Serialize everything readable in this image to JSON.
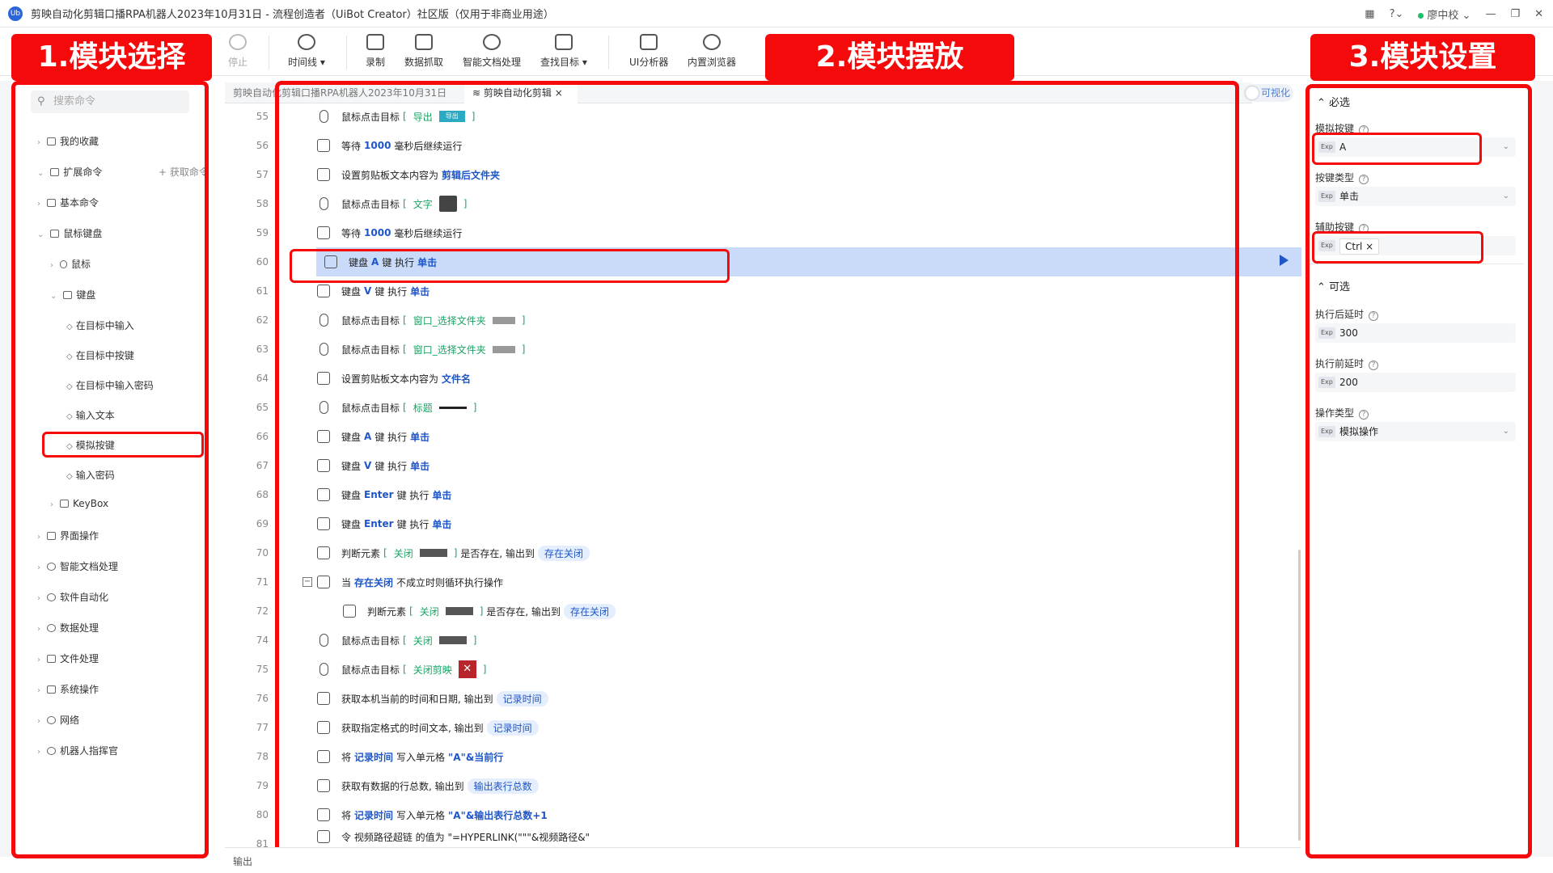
{
  "window": {
    "title": "剪映自动化剪辑口播RPA机器人2023年10月31日 - 流程创造者（UiBot Creator）社区版（仅用于非商业用途）",
    "user": "廖中校",
    "logo": "Ub"
  },
  "toolbar": {
    "stop": "停止",
    "timeline": "时间线",
    "record": "录制",
    "data_scrape": "数据抓取",
    "smart_doc": "智能文档处理",
    "find_target": "查找目标",
    "ui_analyzer": "UI分析器",
    "builtin_browser": "内置浏览器"
  },
  "labels": {
    "section1": "1.模块选择",
    "section2": "2.模块摆放",
    "section3": "3.模块设置"
  },
  "left": {
    "search_placeholder": "搜索命令",
    "get_cmd": "获取命令",
    "items": {
      "fav": "我的收藏",
      "ext": "扩展命令",
      "basic": "基本命令",
      "mousekbd": "鼠标键盘",
      "mouse": "鼠标",
      "kbd": "键盘",
      "k1": "在目标中输入",
      "k2": "在目标中按键",
      "k3": "在目标中输入密码",
      "k4": "输入文本",
      "k5": "模拟按键",
      "k6": "输入密码",
      "keybox": "KeyBox",
      "ui": "界面操作",
      "smartdoc": "智能文档处理",
      "softauto": "软件自动化",
      "data": "数据处理",
      "file": "文件处理",
      "sys": "系统操作",
      "net": "网络",
      "robot": "机器人指挥官"
    }
  },
  "tabs": {
    "tab1": "剪映自动化剪辑口播RPA机器人2023年10月31日",
    "tab2": "剪映自动化剪辑",
    "visual": "可视化"
  },
  "lines": [
    "55",
    "56",
    "57",
    "58",
    "59",
    "60",
    "61",
    "62",
    "63",
    "64",
    "65",
    "66",
    "67",
    "68",
    "69",
    "70",
    "71",
    "72",
    "74",
    "75",
    "76",
    "77",
    "78",
    "79",
    "80",
    "81"
  ],
  "code": {
    "click_target": "鼠标点击目标",
    "lb": "[",
    "rb": "]",
    "export": "导出",
    "wait": "等待",
    "ms": "1000",
    "wait_suffix": "毫秒后继续运行",
    "set_clip": "设置剪贴板文本内容为",
    "clip_after": "剪辑后文件夹",
    "text": "文字",
    "kbd": "键盘",
    "key_a": "A",
    "key_v": "V",
    "key_enter": "Enter",
    "key_exec": "键 执行",
    "single": "单击",
    "win_sel": "窗口_选择文件夹",
    "filename": "文件名",
    "title": "标题",
    "judge": "判断元素",
    "close": "关闭",
    "exists": "是否存在, 输出到",
    "exist_close": "存在关闭",
    "when": "当",
    "loop_suffix": "不成立时则循环执行操作",
    "close_jy": "关闭剪映",
    "get_time": "获取本机当前的时间和日期, 输出到",
    "rec_time": "记录时间",
    "get_fmt": "获取指定格式的时间文本, 输出到",
    "write": "将",
    "write_cell": "写入单元格",
    "cur_row": "\"A\"&当前行",
    "get_rows": "获取有数据的行总数, 输出到",
    "total_rows": "输出表行总数",
    "total_plus": "\"A\"&输出表行总数+1",
    "last_line": "令 视频路径超链 的值为 \"=HYPERLINK(\"\"\"&视频路径&\""
  },
  "right": {
    "required": "必选",
    "key_label": "模拟按键",
    "key_value": "A",
    "type_label": "按键类型",
    "type_value": "单击",
    "aux_label": "辅助按键",
    "aux_value": "Ctrl",
    "optional": "可选",
    "after_label": "执行后延时",
    "after_value": "300",
    "before_label": "执行前延时",
    "before_value": "200",
    "op_label": "操作类型",
    "op_value": "模拟操作",
    "exp": "Exp"
  },
  "bottom": {
    "output": "输出"
  },
  "colors": {
    "accent": "#1e56c9",
    "highlight": "#c9dbf8",
    "red": "#f40a0a"
  }
}
